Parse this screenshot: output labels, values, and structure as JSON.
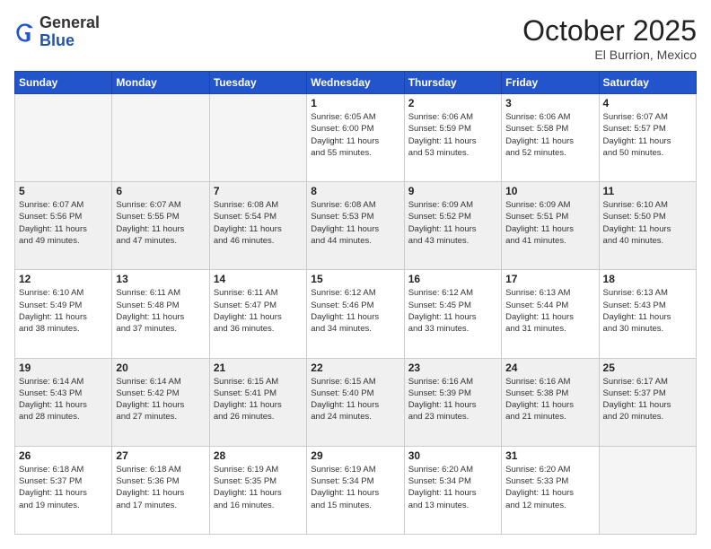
{
  "header": {
    "logo_general": "General",
    "logo_blue": "Blue",
    "month": "October 2025",
    "location": "El Burrion, Mexico"
  },
  "weekdays": [
    "Sunday",
    "Monday",
    "Tuesday",
    "Wednesday",
    "Thursday",
    "Friday",
    "Saturday"
  ],
  "weeks": [
    [
      {
        "day": "",
        "info": ""
      },
      {
        "day": "",
        "info": ""
      },
      {
        "day": "",
        "info": ""
      },
      {
        "day": "1",
        "info": "Sunrise: 6:05 AM\nSunset: 6:00 PM\nDaylight: 11 hours\nand 55 minutes."
      },
      {
        "day": "2",
        "info": "Sunrise: 6:06 AM\nSunset: 5:59 PM\nDaylight: 11 hours\nand 53 minutes."
      },
      {
        "day": "3",
        "info": "Sunrise: 6:06 AM\nSunset: 5:58 PM\nDaylight: 11 hours\nand 52 minutes."
      },
      {
        "day": "4",
        "info": "Sunrise: 6:07 AM\nSunset: 5:57 PM\nDaylight: 11 hours\nand 50 minutes."
      }
    ],
    [
      {
        "day": "5",
        "info": "Sunrise: 6:07 AM\nSunset: 5:56 PM\nDaylight: 11 hours\nand 49 minutes."
      },
      {
        "day": "6",
        "info": "Sunrise: 6:07 AM\nSunset: 5:55 PM\nDaylight: 11 hours\nand 47 minutes."
      },
      {
        "day": "7",
        "info": "Sunrise: 6:08 AM\nSunset: 5:54 PM\nDaylight: 11 hours\nand 46 minutes."
      },
      {
        "day": "8",
        "info": "Sunrise: 6:08 AM\nSunset: 5:53 PM\nDaylight: 11 hours\nand 44 minutes."
      },
      {
        "day": "9",
        "info": "Sunrise: 6:09 AM\nSunset: 5:52 PM\nDaylight: 11 hours\nand 43 minutes."
      },
      {
        "day": "10",
        "info": "Sunrise: 6:09 AM\nSunset: 5:51 PM\nDaylight: 11 hours\nand 41 minutes."
      },
      {
        "day": "11",
        "info": "Sunrise: 6:10 AM\nSunset: 5:50 PM\nDaylight: 11 hours\nand 40 minutes."
      }
    ],
    [
      {
        "day": "12",
        "info": "Sunrise: 6:10 AM\nSunset: 5:49 PM\nDaylight: 11 hours\nand 38 minutes."
      },
      {
        "day": "13",
        "info": "Sunrise: 6:11 AM\nSunset: 5:48 PM\nDaylight: 11 hours\nand 37 minutes."
      },
      {
        "day": "14",
        "info": "Sunrise: 6:11 AM\nSunset: 5:47 PM\nDaylight: 11 hours\nand 36 minutes."
      },
      {
        "day": "15",
        "info": "Sunrise: 6:12 AM\nSunset: 5:46 PM\nDaylight: 11 hours\nand 34 minutes."
      },
      {
        "day": "16",
        "info": "Sunrise: 6:12 AM\nSunset: 5:45 PM\nDaylight: 11 hours\nand 33 minutes."
      },
      {
        "day": "17",
        "info": "Sunrise: 6:13 AM\nSunset: 5:44 PM\nDaylight: 11 hours\nand 31 minutes."
      },
      {
        "day": "18",
        "info": "Sunrise: 6:13 AM\nSunset: 5:43 PM\nDaylight: 11 hours\nand 30 minutes."
      }
    ],
    [
      {
        "day": "19",
        "info": "Sunrise: 6:14 AM\nSunset: 5:43 PM\nDaylight: 11 hours\nand 28 minutes."
      },
      {
        "day": "20",
        "info": "Sunrise: 6:14 AM\nSunset: 5:42 PM\nDaylight: 11 hours\nand 27 minutes."
      },
      {
        "day": "21",
        "info": "Sunrise: 6:15 AM\nSunset: 5:41 PM\nDaylight: 11 hours\nand 26 minutes."
      },
      {
        "day": "22",
        "info": "Sunrise: 6:15 AM\nSunset: 5:40 PM\nDaylight: 11 hours\nand 24 minutes."
      },
      {
        "day": "23",
        "info": "Sunrise: 6:16 AM\nSunset: 5:39 PM\nDaylight: 11 hours\nand 23 minutes."
      },
      {
        "day": "24",
        "info": "Sunrise: 6:16 AM\nSunset: 5:38 PM\nDaylight: 11 hours\nand 21 minutes."
      },
      {
        "day": "25",
        "info": "Sunrise: 6:17 AM\nSunset: 5:37 PM\nDaylight: 11 hours\nand 20 minutes."
      }
    ],
    [
      {
        "day": "26",
        "info": "Sunrise: 6:18 AM\nSunset: 5:37 PM\nDaylight: 11 hours\nand 19 minutes."
      },
      {
        "day": "27",
        "info": "Sunrise: 6:18 AM\nSunset: 5:36 PM\nDaylight: 11 hours\nand 17 minutes."
      },
      {
        "day": "28",
        "info": "Sunrise: 6:19 AM\nSunset: 5:35 PM\nDaylight: 11 hours\nand 16 minutes."
      },
      {
        "day": "29",
        "info": "Sunrise: 6:19 AM\nSunset: 5:34 PM\nDaylight: 11 hours\nand 15 minutes."
      },
      {
        "day": "30",
        "info": "Sunrise: 6:20 AM\nSunset: 5:34 PM\nDaylight: 11 hours\nand 13 minutes."
      },
      {
        "day": "31",
        "info": "Sunrise: 6:20 AM\nSunset: 5:33 PM\nDaylight: 11 hours\nand 12 minutes."
      },
      {
        "day": "",
        "info": ""
      }
    ]
  ]
}
